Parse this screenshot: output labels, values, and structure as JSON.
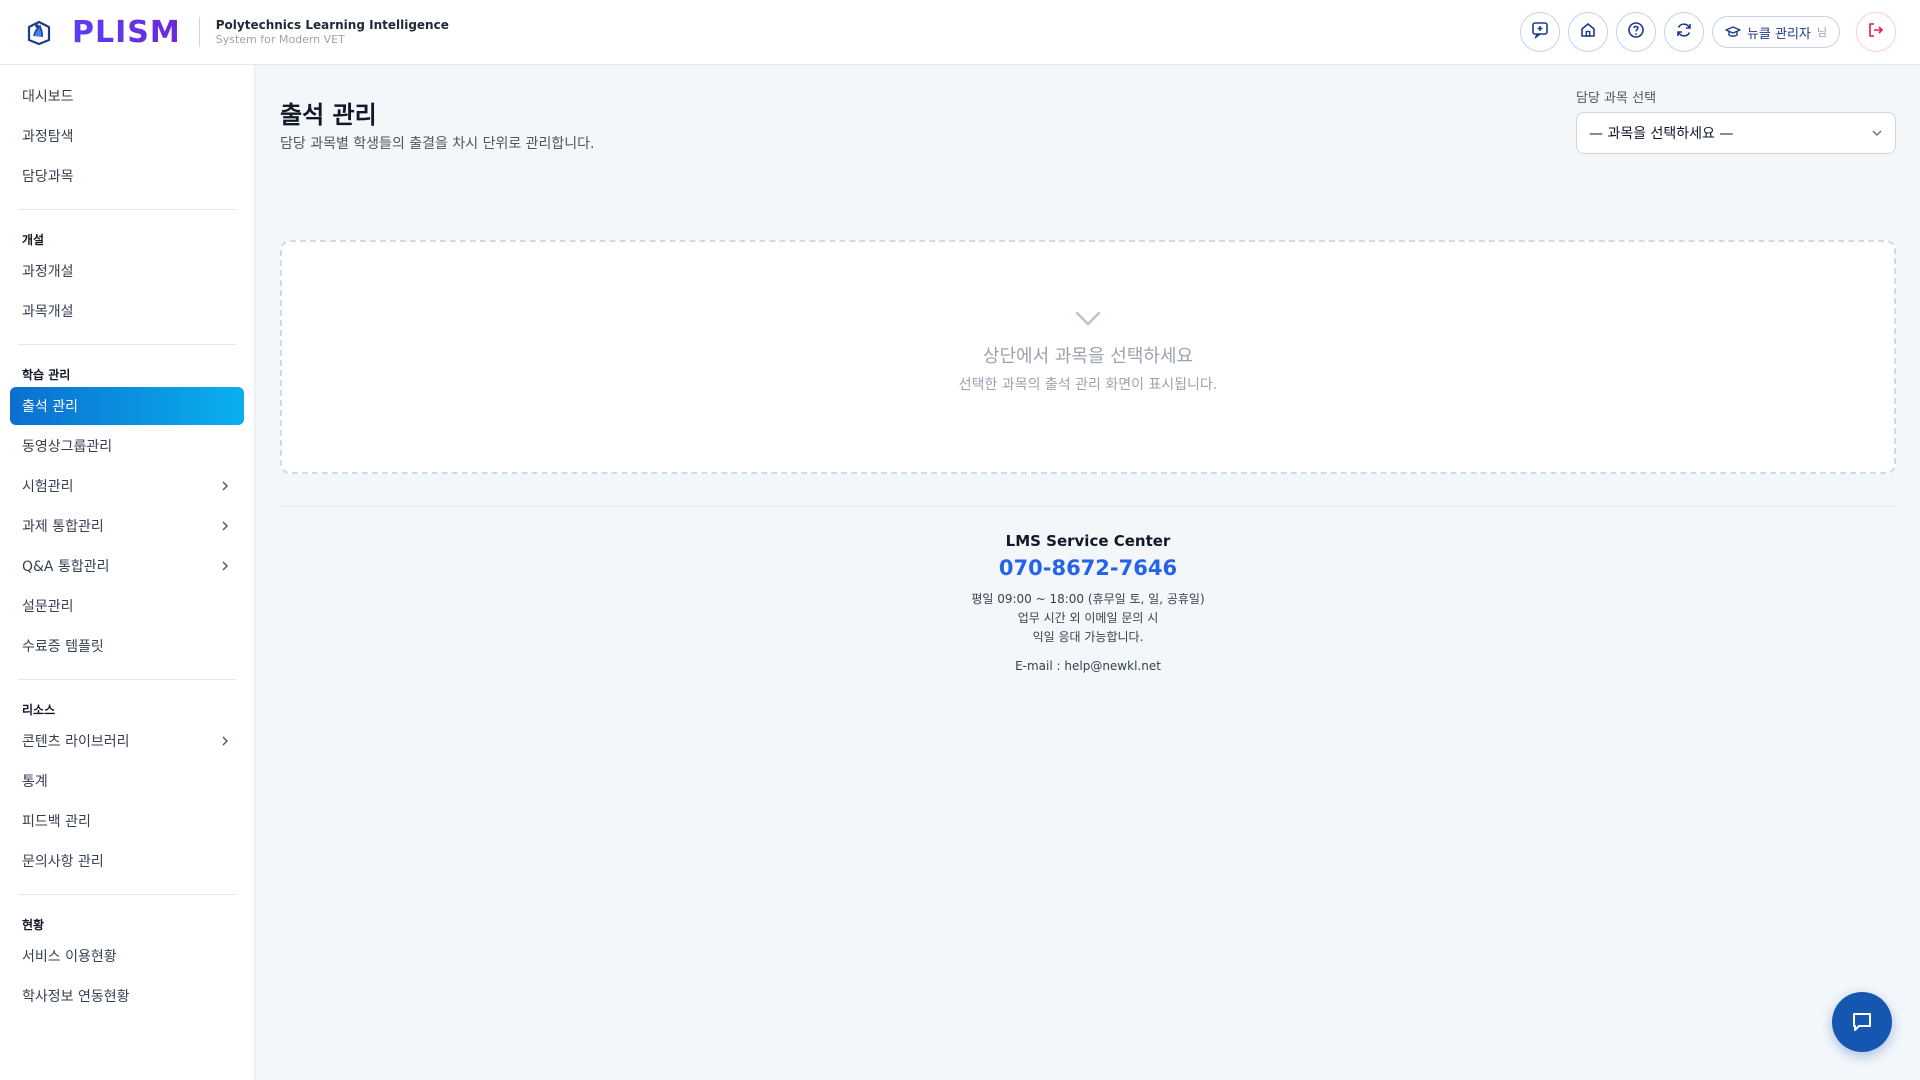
{
  "header": {
    "brand": "PLISM",
    "tagline_title": "Polytechnics Learning Intelligence",
    "tagline_sub": "System for Modern VET",
    "user_name": "뉴클 관리자",
    "user_suffix": "님",
    "icons": [
      "new-post-icon",
      "home-icon",
      "help-icon",
      "refresh-icon",
      "graduation-cap-icon",
      "logout-icon"
    ]
  },
  "sidebar": {
    "group0": [
      {
        "label": "대시보드"
      },
      {
        "label": "과정탐색"
      },
      {
        "label": "담당과목"
      }
    ],
    "section1": "개설",
    "group1": [
      {
        "label": "과정개설"
      },
      {
        "label": "과목개설"
      }
    ],
    "section2": "학습 관리",
    "group2": [
      {
        "label": "출석 관리",
        "active": true
      },
      {
        "label": "동영상그룹관리"
      },
      {
        "label": "시험관리",
        "has_children": true
      },
      {
        "label": "과제 통합관리",
        "has_children": true
      },
      {
        "label": "Q&A 통합관리",
        "has_children": true
      },
      {
        "label": "설문관리"
      },
      {
        "label": "수료증 템플릿"
      }
    ],
    "section3": "리소스",
    "group3": [
      {
        "label": "콘텐츠 라이브러리",
        "has_children": true
      },
      {
        "label": "통계"
      },
      {
        "label": "피드백 관리"
      },
      {
        "label": "문의사항 관리"
      }
    ],
    "section4": "현황",
    "group4": [
      {
        "label": "서비스 이용현황"
      },
      {
        "label": "학사정보 연동현황"
      }
    ]
  },
  "main": {
    "title": "출석 관리",
    "description": "담당 과목별 학생들의 출결을 차시 단위로 관리합니다.",
    "course_select": {
      "label": "담당 과목 선택",
      "value": "— 과목을 선택하세요 —"
    },
    "empty": {
      "title": "상단에서 과목을 선택하세요",
      "subtitle": "선택한 과목의 출석 관리 화면이 표시됩니다."
    }
  },
  "footer": {
    "title": "LMS Service Center",
    "phone": "070-8672-7646",
    "hours_line1": "평일 09:00 ~ 18:00 (휴무일 토, 일, 공휴일)",
    "hours_line2": "업무 시간 외 이메일 문의 시",
    "hours_line3": "익일 응대 가능합니다.",
    "email": "E-mail : help@newkl.net"
  },
  "colors": {
    "brand": "#5b3df5",
    "active_nav_start": "#0b6fcf",
    "active_nav_end": "#0ab0ee",
    "phone": "#2563eb",
    "fab": "#1557b0"
  }
}
